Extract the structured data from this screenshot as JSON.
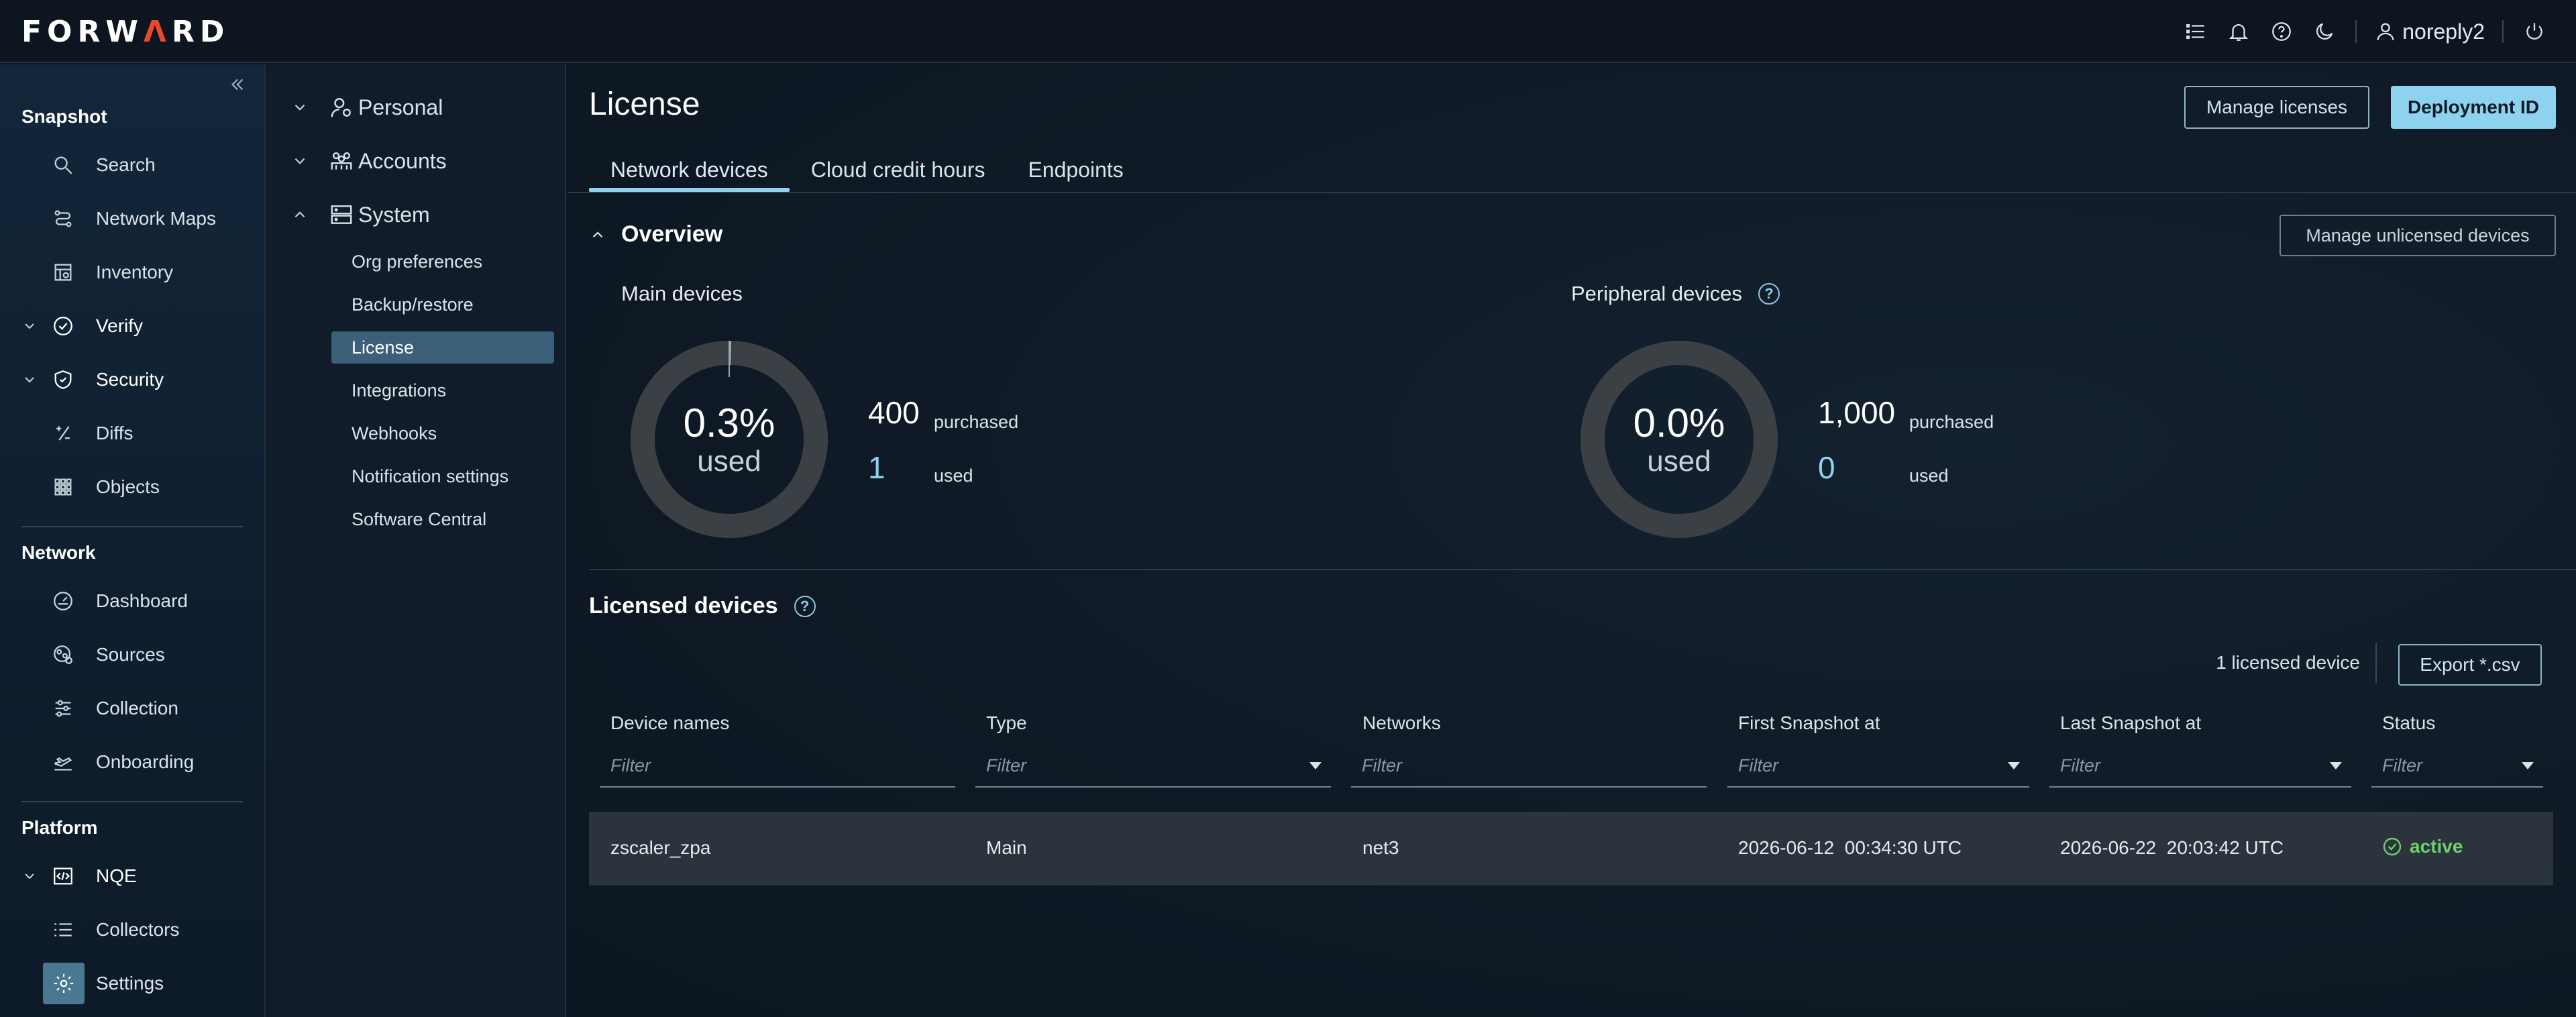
{
  "app": {
    "logo_pre": "FORW",
    "logo_accent": "Ʌ",
    "logo_post": "RD",
    "user": "noreply2",
    "accent_color": "#8dd3ef",
    "success_color": "#6fcf6a"
  },
  "leftnav": {
    "sections": [
      {
        "title": "Snapshot"
      },
      {
        "title": "Network"
      },
      {
        "title": "Platform"
      }
    ],
    "items": [
      {
        "label": "Search",
        "icon": "search-icon"
      },
      {
        "label": "Network Maps",
        "icon": "network-maps-icon"
      },
      {
        "label": "Inventory",
        "icon": "inventory-icon"
      },
      {
        "label": "Verify",
        "icon": "check-circle-icon"
      },
      {
        "label": "Security",
        "icon": "shield-icon"
      },
      {
        "label": "Diffs",
        "icon": "diffs-icon"
      },
      {
        "label": "Objects",
        "icon": "grid-icon"
      },
      {
        "label": "Dashboard",
        "icon": "gauge-icon"
      },
      {
        "label": "Sources",
        "icon": "sources-icon"
      },
      {
        "label": "Collection",
        "icon": "sliders-icon"
      },
      {
        "label": "Onboarding",
        "icon": "onboarding-icon"
      },
      {
        "label": "NQE",
        "icon": "code-icon"
      },
      {
        "label": "Collectors",
        "icon": "list-icon"
      },
      {
        "label": "Settings",
        "icon": "gear-icon"
      }
    ]
  },
  "settingsnav": {
    "groups": [
      {
        "label": "Personal"
      },
      {
        "label": "Accounts"
      },
      {
        "label": "System"
      }
    ],
    "items": [
      "Org preferences",
      "Backup/restore",
      "License",
      "Integrations",
      "Webhooks",
      "Notification settings",
      "Software Central"
    ]
  },
  "main": {
    "title": "License",
    "manage_licenses": "Manage licenses",
    "deployment_id": "Deployment ID",
    "tabs": [
      "Network devices",
      "Cloud credit hours",
      "Endpoints"
    ],
    "overview": {
      "title": "Overview",
      "manage_unlicensed": "Manage unlicensed devices",
      "main": {
        "title": "Main devices",
        "percent": "0.3%",
        "used_word": "used",
        "purchased": "400",
        "purchased_label": "purchased",
        "used": "1",
        "used_label": "used",
        "fraction": 0.0025
      },
      "peripheral": {
        "title": "Peripheral devices",
        "percent": "0.0%",
        "used_word": "used",
        "purchased": "1,000",
        "purchased_label": "purchased",
        "used": "0",
        "used_label": "used",
        "fraction": 0
      }
    },
    "licensed": {
      "title": "Licensed devices",
      "count": "1 licensed device",
      "export": "Export *.csv",
      "columns": [
        "Device names",
        "Type",
        "Networks",
        "First Snapshot at",
        "Last Snapshot at",
        "Status"
      ],
      "filter_placeholder": "Filter",
      "rows": [
        {
          "name": "zscaler_zpa",
          "type": "Main",
          "network": "net3",
          "first": "2026-06-12  00:34:30 UTC",
          "last": "2026-06-22  20:03:42 UTC",
          "status": "active"
        }
      ]
    }
  }
}
